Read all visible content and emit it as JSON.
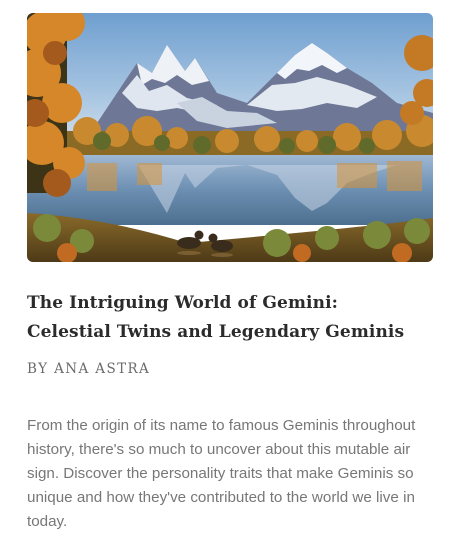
{
  "article": {
    "image_alt": "Painting of snowy mountain peaks reflected in a lake surrounded by autumn trees with two ducks",
    "title": "The Intriguing World of Gemini: Celestial Twins and Legendary Geminis",
    "byline": "BY ANA ASTRA",
    "excerpt": "From the origin of its name to famous Geminis throughout history, there's so much to uncover about this mutable air sign. Discover the personality traits that make Geminis so unique and how they've contributed to the world we live in today."
  },
  "colors": {
    "title": "#2b2b2b",
    "byline": "#6b6b6b",
    "excerpt": "#777777",
    "sky": "#8fb6d8",
    "snow": "#eef2f7",
    "rock": "#6b7390",
    "autumn_orange": "#d7862a",
    "foliage_green": "#5c6b2c",
    "water": "#7fa2c0"
  }
}
